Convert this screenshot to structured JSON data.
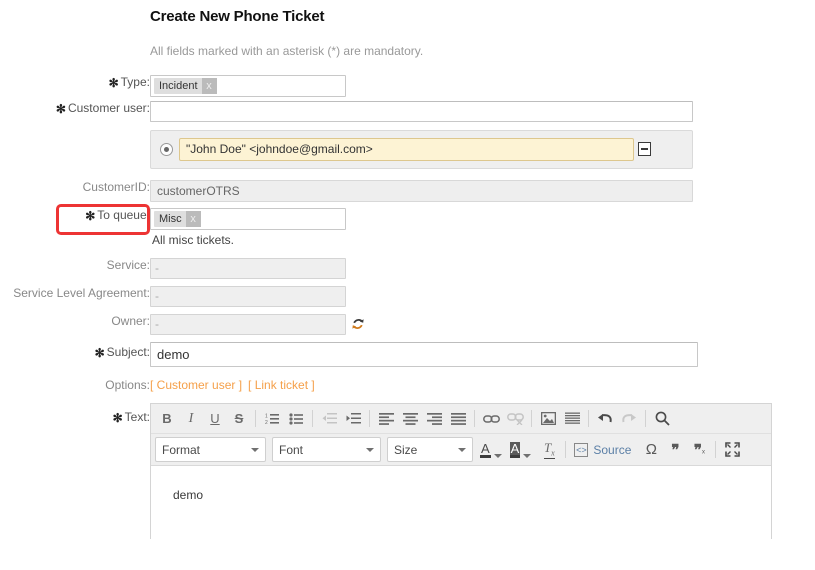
{
  "header": {
    "title": "Create New Phone Ticket",
    "subtitle": "All fields marked with an asterisk (*) are mandatory."
  },
  "form": {
    "type": {
      "label": "Type:",
      "required": true,
      "token": "Incident",
      "token_remove": "x"
    },
    "customer_user": {
      "label": "Customer user:",
      "required": true,
      "value": "",
      "placeholder": ""
    },
    "customer_result": {
      "value": "\"John Doe\" <johndoe@gmail.com>",
      "radio_selected": true,
      "remove_label": "−"
    },
    "customer_id": {
      "label": "CustomerID:",
      "required": false,
      "value": "customerOTRS"
    },
    "to_queue": {
      "label": "To queue:",
      "required": true,
      "token": "Misc",
      "token_remove": "x",
      "hint": "All misc tickets.",
      "highlight_color": "#ed3434"
    },
    "service": {
      "label": "Service:",
      "required": false,
      "value": "-",
      "disabled": true
    },
    "sla": {
      "label": "Service Level Agreement:",
      "required": false,
      "value": "-",
      "disabled": true
    },
    "owner": {
      "label": "Owner:",
      "required": false,
      "value": "-",
      "disabled": true,
      "refresh_icon": "refresh-icon"
    },
    "subject": {
      "label": "Subject:",
      "required": true,
      "value": "demo"
    },
    "options": {
      "label": "Options:",
      "links": [
        "[ Customer user ]",
        "[ Link ticket ]"
      ],
      "link_color": "#f5a04a"
    },
    "text": {
      "label": "Text:",
      "required": true,
      "body": "demo"
    }
  },
  "editor": {
    "toolbar_row1": [
      {
        "name": "bold-icon",
        "glyph": "B",
        "enabled": true
      },
      {
        "name": "italic-icon",
        "glyph": "I",
        "enabled": true
      },
      {
        "name": "underline-icon",
        "glyph": "U",
        "enabled": true
      },
      {
        "name": "strikethrough-icon",
        "glyph": "S",
        "enabled": true
      },
      {
        "name": "numbered-list-icon",
        "glyph": "list-num",
        "enabled": true
      },
      {
        "name": "bulleted-list-icon",
        "glyph": "list-bul",
        "enabled": true
      },
      {
        "name": "decrease-indent-icon",
        "glyph": "outdent",
        "enabled": false
      },
      {
        "name": "increase-indent-icon",
        "glyph": "indent",
        "enabled": true
      },
      {
        "name": "align-left-icon",
        "glyph": "align-left",
        "enabled": true
      },
      {
        "name": "align-center-icon",
        "glyph": "align-center",
        "enabled": true
      },
      {
        "name": "align-right-icon",
        "glyph": "align-right",
        "enabled": true
      },
      {
        "name": "align-justify-icon",
        "glyph": "align-justify",
        "enabled": true
      },
      {
        "name": "link-icon",
        "glyph": "link",
        "enabled": true
      },
      {
        "name": "unlink-icon",
        "glyph": "unlink",
        "enabled": false
      },
      {
        "name": "image-icon",
        "glyph": "image",
        "enabled": true
      },
      {
        "name": "horizontal-rule-icon",
        "glyph": "hrule",
        "enabled": true
      },
      {
        "name": "undo-icon",
        "glyph": "undo",
        "enabled": true
      },
      {
        "name": "redo-icon",
        "glyph": "redo",
        "enabled": false
      },
      {
        "name": "find-icon",
        "glyph": "search",
        "enabled": true
      }
    ],
    "selects": [
      {
        "name": "format-select",
        "label": "Format"
      },
      {
        "name": "font-select",
        "label": "Font"
      },
      {
        "name": "size-select",
        "label": "Size"
      }
    ],
    "toolbar_row2": [
      {
        "name": "text-color-icon",
        "glyph": "A",
        "enabled": true
      },
      {
        "name": "background-color-icon",
        "glyph": "A",
        "enabled": true
      },
      {
        "name": "remove-format-icon",
        "glyph": "Tx",
        "enabled": true
      }
    ],
    "source_label": "Source",
    "toolbar_row2_tail": [
      {
        "name": "special-character-icon",
        "glyph": "Ω",
        "enabled": true
      },
      {
        "name": "blockquote-icon",
        "glyph": "quote",
        "enabled": true
      },
      {
        "name": "remove-quote-icon",
        "glyph": "quote-x",
        "enabled": true
      },
      {
        "name": "maximize-icon",
        "glyph": "maximize",
        "enabled": true
      }
    ]
  }
}
